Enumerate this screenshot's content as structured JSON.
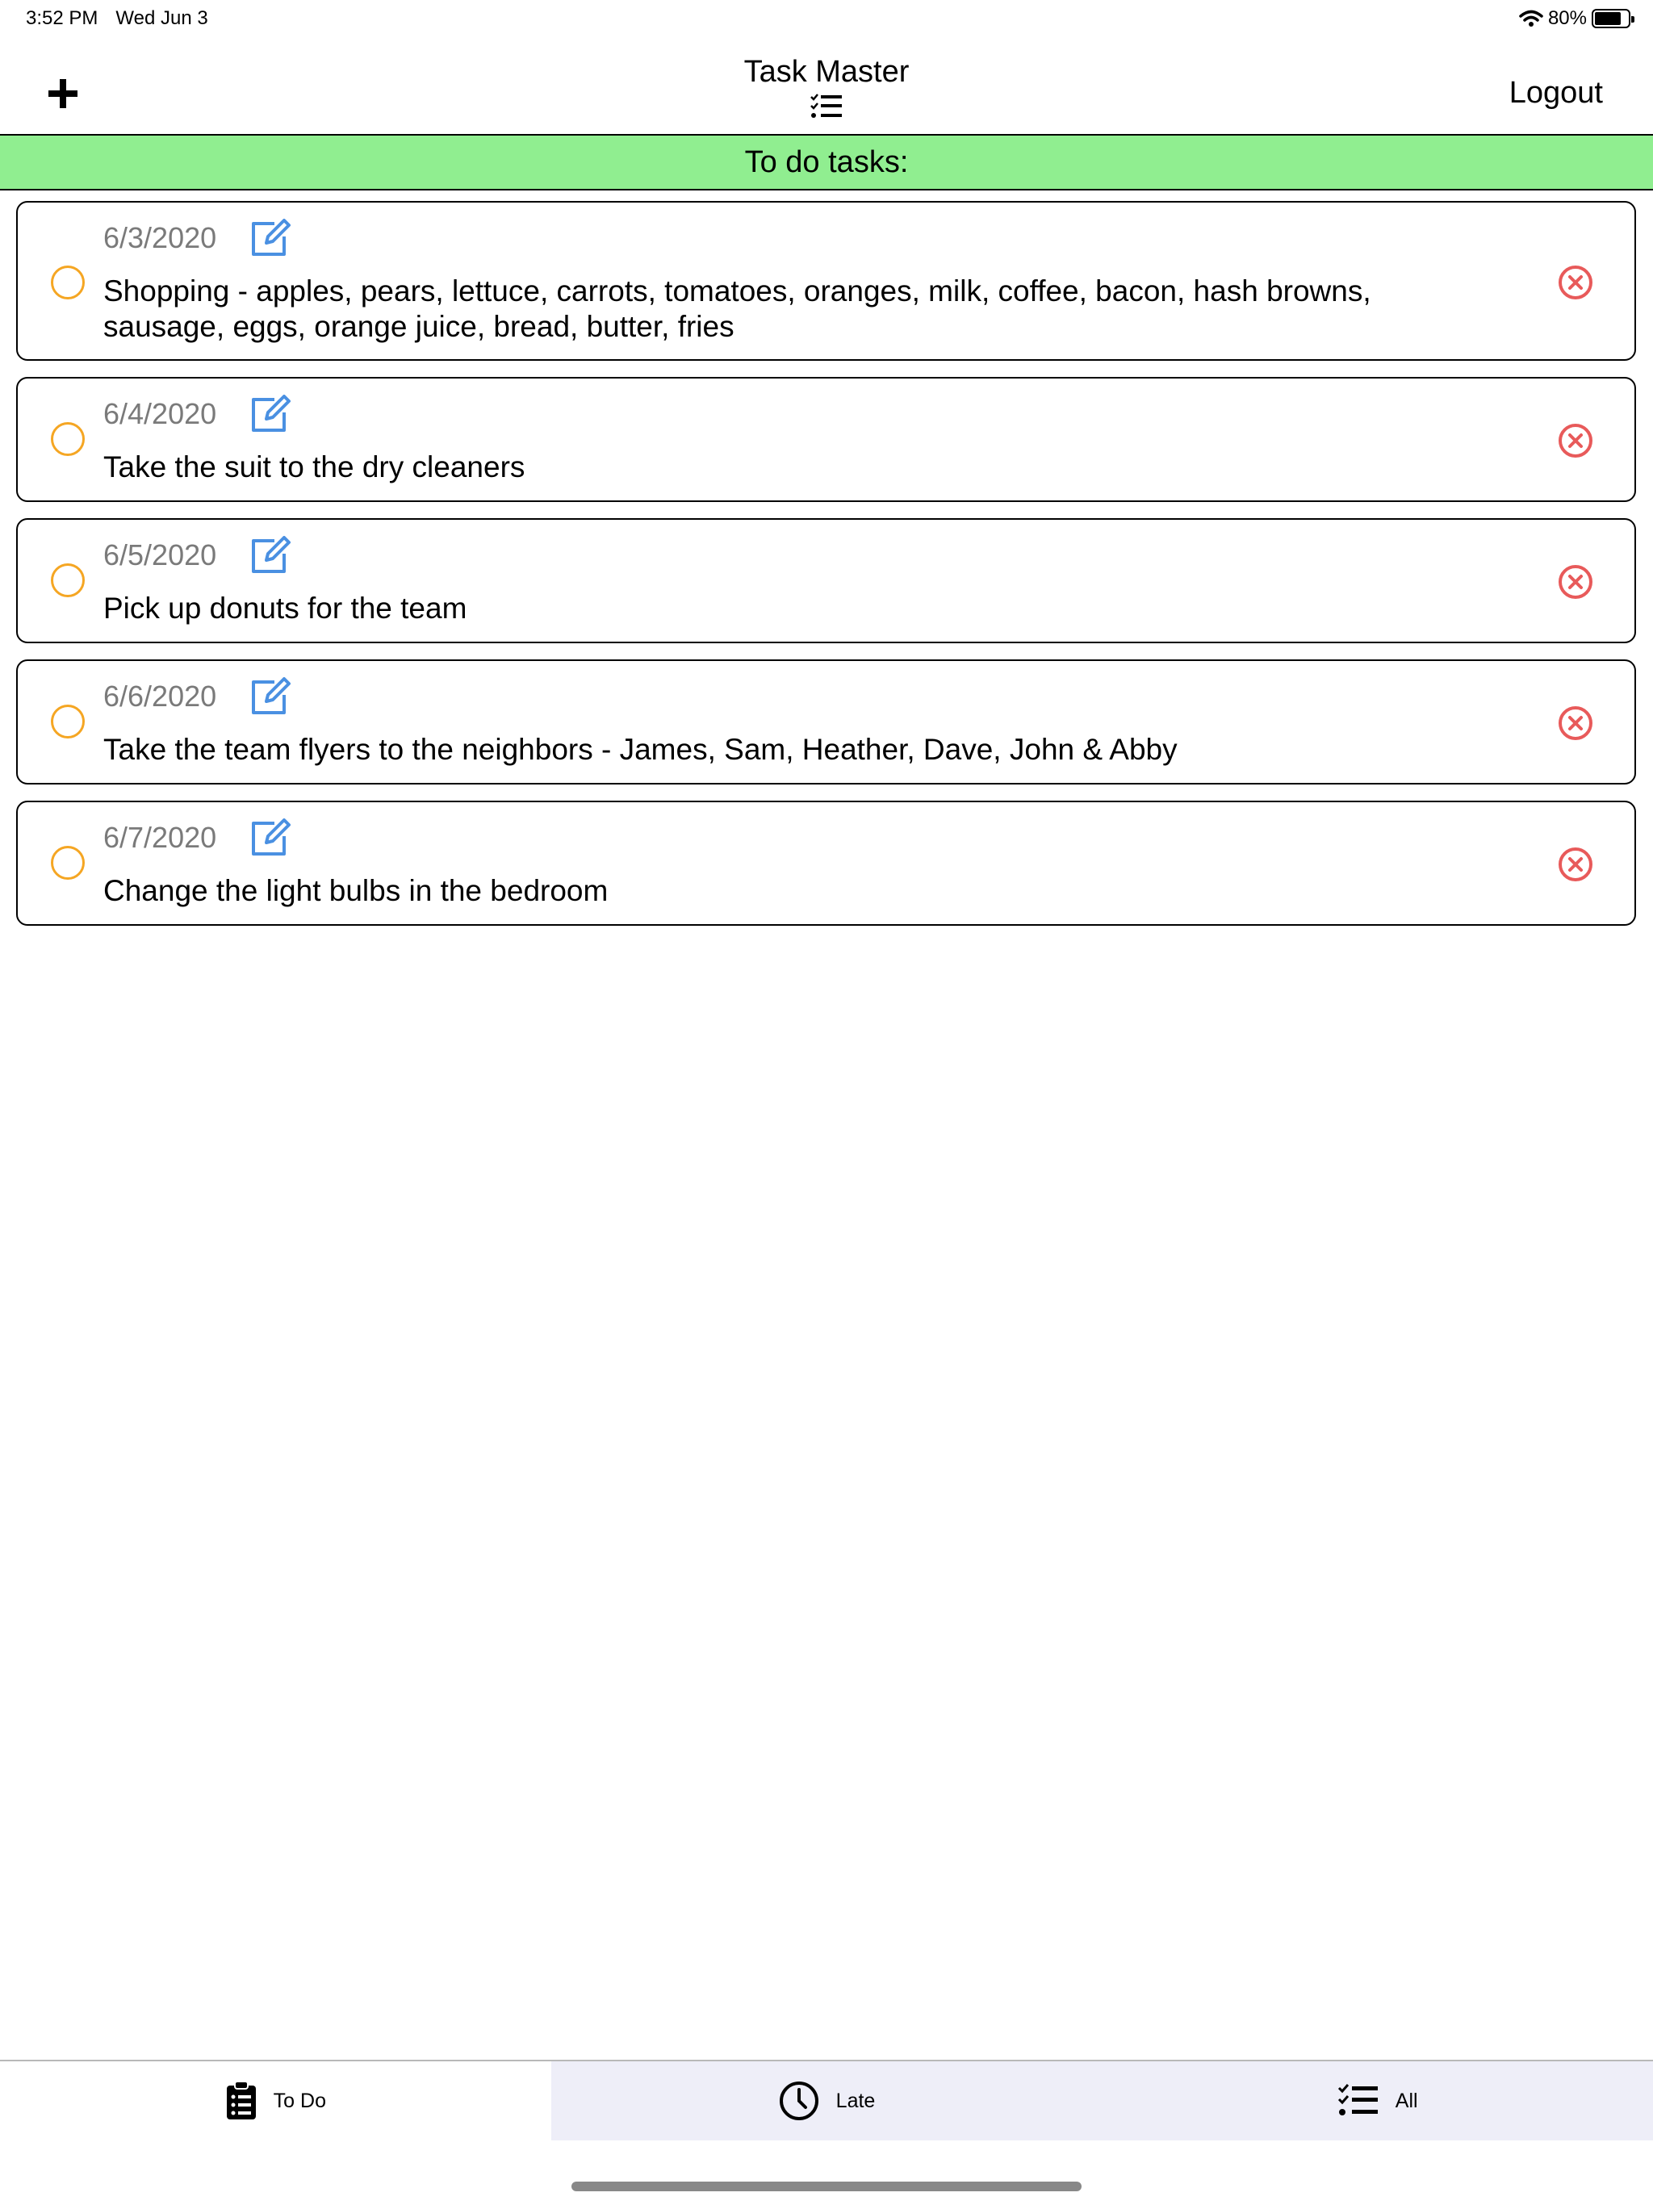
{
  "status_bar": {
    "time": "3:52 PM",
    "date": "Wed Jun 3",
    "battery": "80%",
    "battery_level": 0.8,
    "wifi_icon": "wifi-icon"
  },
  "nav": {
    "title": "Task Master",
    "title_icon": "checklist-icon",
    "add_icon": "plus-icon",
    "logout_label": "Logout"
  },
  "section": {
    "title": "To do tasks:",
    "background": "#90ee90"
  },
  "tasks": [
    {
      "date": "6/3/2020",
      "text": "Shopping - apples, pears, lettuce, carrots, tomatoes, oranges, milk, coffee, bacon, hash browns, sausage, eggs, orange juice, bread, butter, fries"
    },
    {
      "date": "6/4/2020",
      "text": "Take the suit to the dry cleaners"
    },
    {
      "date": "6/5/2020",
      "text": "Pick up donuts for the team"
    },
    {
      "date": "6/6/2020",
      "text": "Take the team flyers to the neighbors - James, Sam, Heather, Dave, John & Abby"
    },
    {
      "date": "6/7/2020",
      "text": "Change the light bulbs in the bedroom"
    }
  ],
  "colors": {
    "status_circle": "#f5a623",
    "edit_icon": "#4a90e2",
    "delete_icon": "#e85a5a",
    "inactive_tab_bg": "#eeeef8"
  },
  "tabs": [
    {
      "label": "To Do",
      "icon": "clipboard-list-icon",
      "selected": true
    },
    {
      "label": "Late",
      "icon": "clock-icon",
      "selected": false
    },
    {
      "label": "All",
      "icon": "checklist-icon",
      "selected": false
    }
  ]
}
